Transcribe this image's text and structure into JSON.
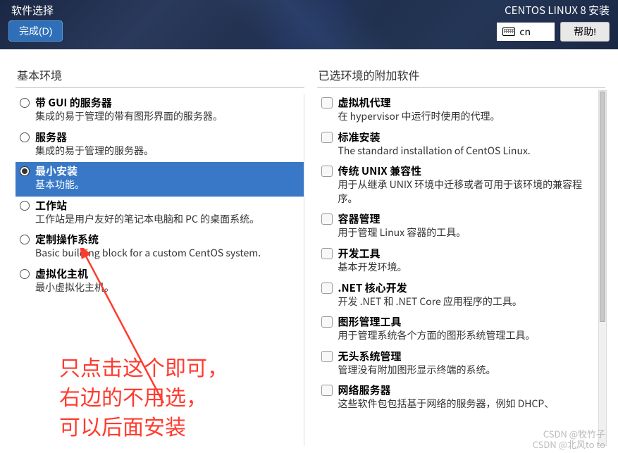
{
  "header": {
    "page_title": "软件选择",
    "done_label": "完成(D)",
    "installer_title": "CENTOS LINUX 8 安装",
    "lang_code": "cn",
    "help_label": "帮助!"
  },
  "left": {
    "title": "基本环境",
    "items": [
      {
        "title": "带 GUI 的服务器",
        "desc": "集成的易于管理的带有图形界面的服务器。",
        "selected": false
      },
      {
        "title": "服务器",
        "desc": "集成的易于管理的服务器。",
        "selected": false
      },
      {
        "title": "最小安装",
        "desc": "基本功能。",
        "selected": true
      },
      {
        "title": "工作站",
        "desc": "工作站是用户友好的笔记本电脑和 PC 的桌面系统。",
        "selected": false
      },
      {
        "title": "定制操作系统",
        "desc": "Basic building block for a custom CentOS system.",
        "selected": false
      },
      {
        "title": "虚拟化主机",
        "desc": "最小虚拟化主机。",
        "selected": false
      }
    ]
  },
  "right": {
    "title": "已选环境的附加软件",
    "items": [
      {
        "title": "虚拟机代理",
        "desc": "在 hypervisor 中运行时使用的代理。"
      },
      {
        "title": "标准安装",
        "desc": "The standard installation of CentOS Linux."
      },
      {
        "title": "传统 UNIX 兼容性",
        "desc": "用于从继承 UNIX 环境中迁移或者可用于该环境的兼容程序。"
      },
      {
        "title": "容器管理",
        "desc": "用于管理 Linux 容器的工具。"
      },
      {
        "title": "开发工具",
        "desc": "基本开发环境。"
      },
      {
        "title": ".NET 核心开发",
        "desc": "开发 .NET 和 .NET Core 应用程序的工具。"
      },
      {
        "title": "图形管理工具",
        "desc": "用于管理系统各个方面的图形系统管理工具。"
      },
      {
        "title": "无头系统管理",
        "desc": "管理没有附加图形显示终端的系统。"
      },
      {
        "title": "网络服务器",
        "desc": "这些软件包包括基于网络的服务器，例如 DHCP、"
      }
    ]
  },
  "annotation": {
    "line1": "只点击这个即可，",
    "line2": "右边的不用选，",
    "line3": "可以后面安装"
  },
  "watermark": {
    "line1": "CSDN @牧竹子",
    "line2": "CSDN @北风to to"
  }
}
